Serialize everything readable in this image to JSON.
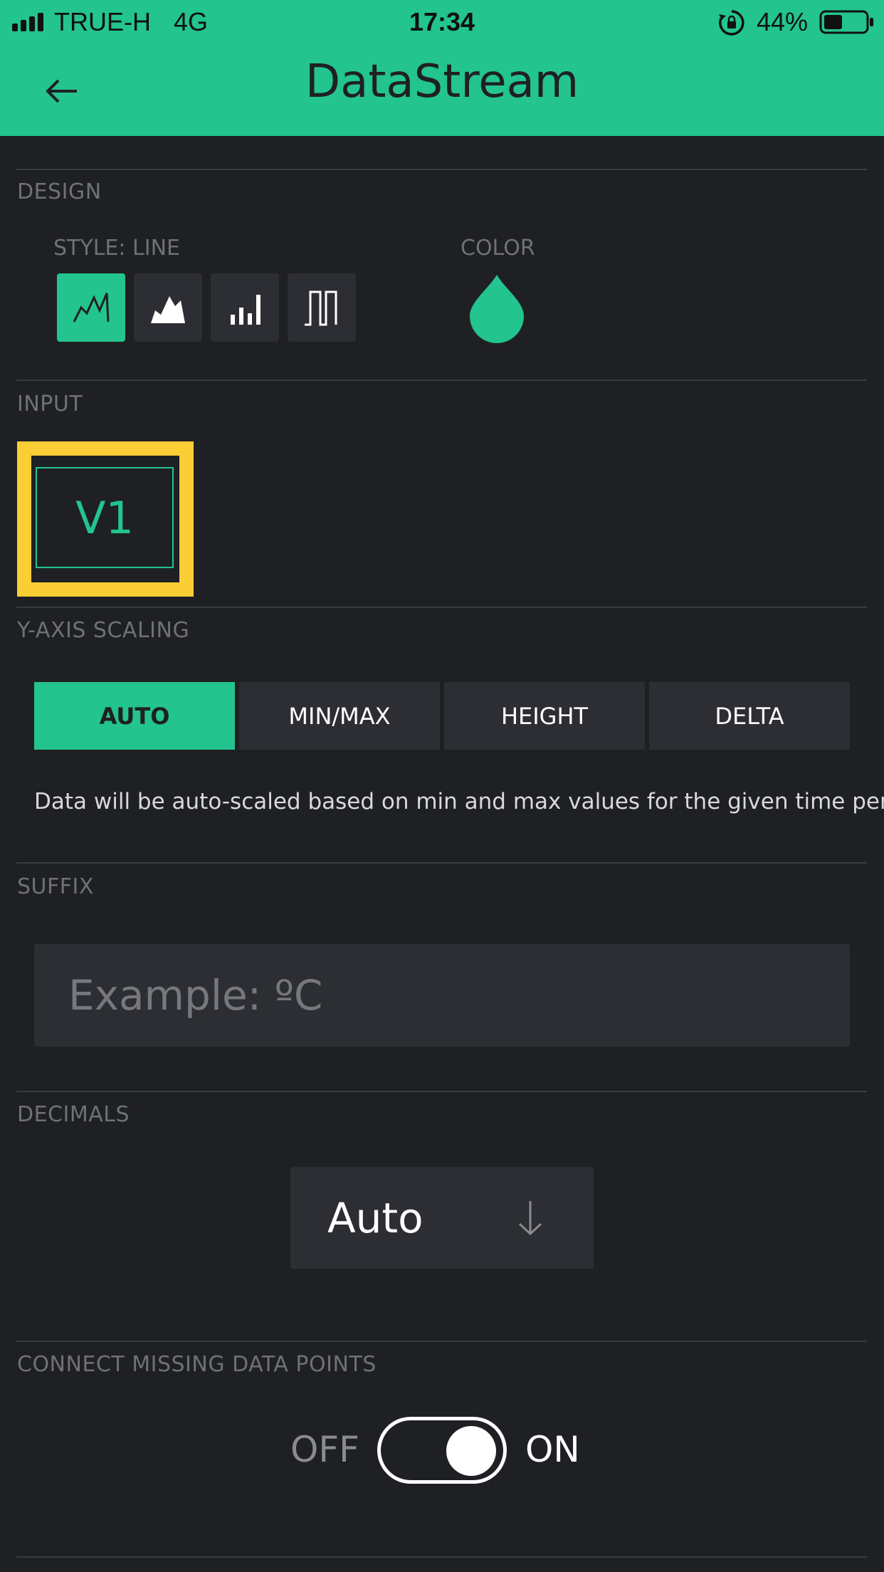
{
  "status_bar": {
    "carrier": "TRUE-H",
    "network": "4G",
    "time": "17:34",
    "battery": "44%",
    "battery_level": 0.44
  },
  "header": {
    "title": "DataStream",
    "back_icon": "arrow-left-icon"
  },
  "design": {
    "section_label": "DESIGN",
    "style_label": "STYLE: LINE",
    "color_label": "COLOR",
    "styles": [
      "line",
      "area",
      "bar",
      "binary"
    ],
    "selected_style": "line",
    "color": "#23c48e"
  },
  "input": {
    "section_label": "INPUT",
    "pin": "V1",
    "highlight_color": "#fcce35"
  },
  "y_axis_scaling": {
    "section_label": "Y-AXIS SCALING",
    "options": [
      "AUTO",
      "MIN/MAX",
      "HEIGHT",
      "DELTA"
    ],
    "selected": "AUTO",
    "description": "Data will be auto-scaled based on min and max values for the given time period"
  },
  "suffix": {
    "section_label": "SUFFIX",
    "placeholder": "Example: ºC",
    "value": ""
  },
  "decimals": {
    "section_label": "DECIMALS",
    "value": "Auto"
  },
  "connect_missing": {
    "section_label": "CONNECT MISSING DATA POINTS",
    "off_label": "OFF",
    "on_label": "ON",
    "state": true
  },
  "colors": {
    "accent": "#23c48e",
    "background": "#1f2024",
    "panel": "#2d2e33",
    "highlight": "#fcce35"
  }
}
